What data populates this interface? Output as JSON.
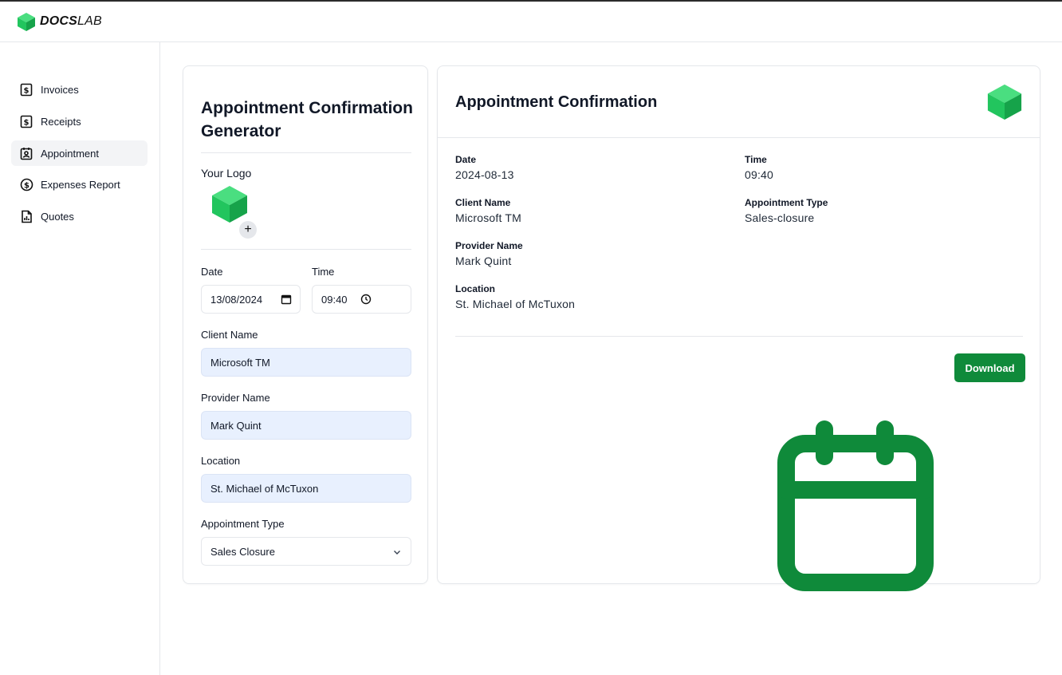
{
  "brand": {
    "bold": "DOCS",
    "light": "LAB",
    "accent": "#22c55e"
  },
  "sidebar": {
    "items": [
      {
        "label": "Invoices",
        "icon": "receipt-dollar-icon",
        "active": false
      },
      {
        "label": "Receipts",
        "icon": "receipt-dollar-icon",
        "active": false
      },
      {
        "label": "Appointment",
        "icon": "contact-card-icon",
        "active": true
      },
      {
        "label": "Expenses Report",
        "icon": "dollar-circle-icon",
        "active": false
      },
      {
        "label": "Quotes",
        "icon": "document-chart-icon",
        "active": false
      }
    ]
  },
  "form": {
    "title": "Appointment Confirmation Generator",
    "logo_label": "Your Logo",
    "add_logo": "+",
    "date_label": "Date",
    "date_value": "13/08/2024",
    "time_label": "Time",
    "time_value": "09:40",
    "client_label": "Client Name",
    "client_value": "Microsoft TM",
    "provider_label": "Provider Name",
    "provider_value": "Mark Quint",
    "location_label": "Location",
    "location_value": "St. Michael of McTuxon",
    "type_label": "Appointment Type",
    "type_value": "Sales Closure"
  },
  "preview": {
    "title": "Appointment Confirmation",
    "date_label": "Date",
    "date_value": "2024-08-13",
    "time_label": "Time",
    "time_value": "09:40",
    "client_label": "Client Name",
    "client_value": "Microsoft TM",
    "type_label": "Appointment Type",
    "type_value": "Sales-closure",
    "provider_label": "Provider Name",
    "provider_value": "Mark Quint",
    "location_label": "Location",
    "location_value": "St. Michael of McTuxon",
    "download_label": "Download",
    "button_color": "#0f8a3a"
  }
}
